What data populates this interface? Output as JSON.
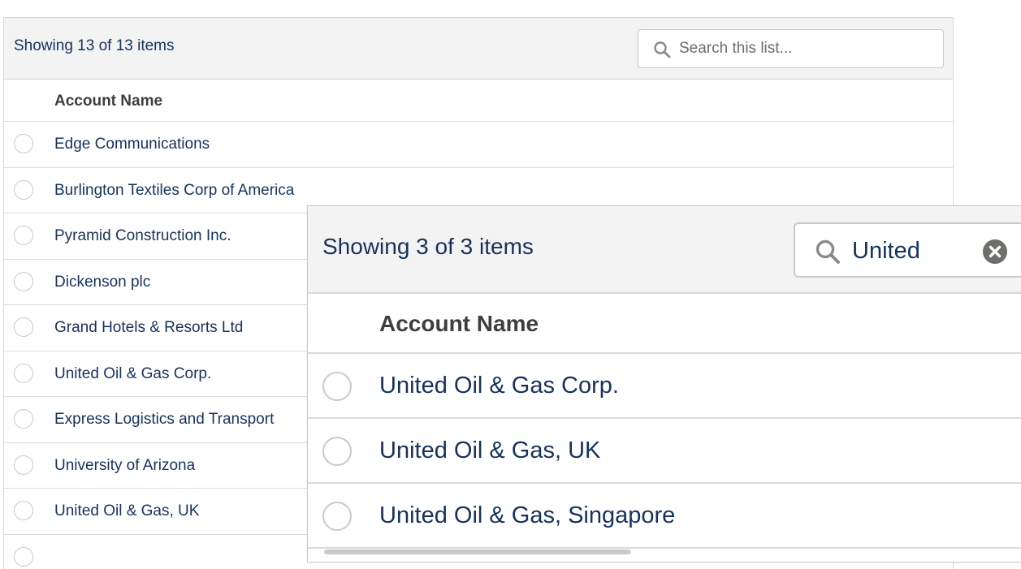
{
  "back_list": {
    "count_text": "Showing 13 of 13 items",
    "search_placeholder": "Search this list...",
    "column_header": "Account Name",
    "rows": [
      "Edge Communications",
      "Burlington Textiles Corp of America",
      "Pyramid Construction Inc.",
      "Dickenson plc",
      "Grand Hotels & Resorts Ltd",
      "United Oil & Gas Corp.",
      "Express Logistics and Transport",
      "University of Arizona",
      "United Oil & Gas, UK"
    ]
  },
  "front_list": {
    "count_text": "Showing 3 of 3 items",
    "search_value": "United",
    "column_header": "Account Name",
    "rows": [
      "United Oil & Gas Corp.",
      "United Oil & Gas, UK",
      "United Oil & Gas, Singapore"
    ]
  },
  "icons": {
    "search": "search-icon",
    "clear": "clear-icon",
    "radio": "radio-button"
  }
}
